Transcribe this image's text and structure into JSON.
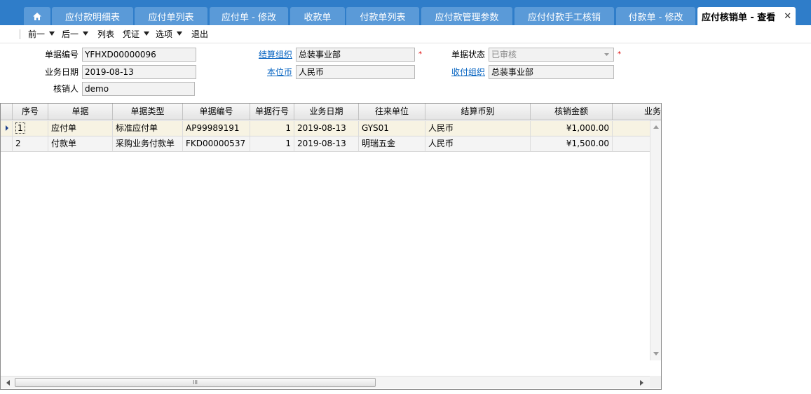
{
  "tabs": [
    {
      "label": "应付款明细表"
    },
    {
      "label": "应付单列表"
    },
    {
      "label": "应付单 - 修改"
    },
    {
      "label": "收款单"
    },
    {
      "label": "付款单列表"
    },
    {
      "label": "应付款管理参数"
    },
    {
      "label": "应付付款手工核销"
    },
    {
      "label": "付款单 - 修改"
    },
    {
      "label": "应付核销单 - 查看",
      "active": true
    }
  ],
  "toolbar": {
    "prev": "前一",
    "next": "后一",
    "list": "列表",
    "voucher": "凭证",
    "options": "选项",
    "exit": "退出"
  },
  "form": {
    "doc_no_label": "单据编号",
    "doc_no": "YFHXD00000096",
    "biz_date_label": "业务日期",
    "biz_date": "2019-08-13",
    "verifier_label": "核销人",
    "verifier": "demo",
    "settle_org_label": "结算组织",
    "settle_org": "总装事业部",
    "local_currency_label": "本位币",
    "local_currency": "人民币",
    "status_label": "单据状态",
    "status": "已审核",
    "pay_org_label": "收付组织",
    "pay_org": "总装事业部",
    "required_mark": "*"
  },
  "grid": {
    "columns": [
      "序号",
      "单据",
      "单据类型",
      "单据编号",
      "单据行号",
      "业务日期",
      "往来单位",
      "结算币别",
      "核销金额",
      "业务"
    ],
    "rows": [
      [
        "1",
        "应付单",
        "标准应付单",
        "AP99989191",
        "1",
        "2019-08-13",
        "GYS01",
        "人民币",
        "¥1,000.00"
      ],
      [
        "2",
        "付款单",
        "采购业务付款单",
        "FKD00000537",
        "1",
        "2019-08-13",
        "明瑞五金",
        "人民币",
        "¥1,500.00"
      ]
    ],
    "hscroll_grip": "III"
  }
}
